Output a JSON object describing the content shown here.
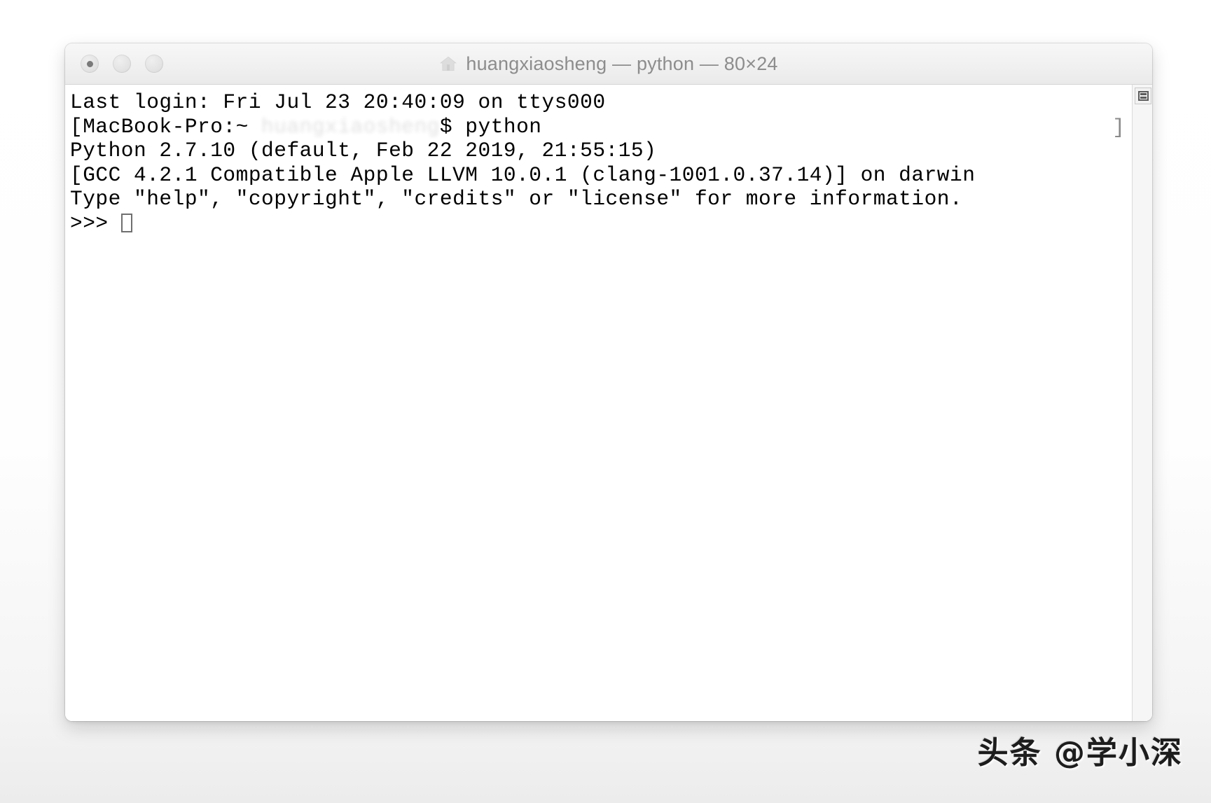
{
  "window": {
    "title": "huangxiaosheng — python — 80×24",
    "title_icon": "home-icon",
    "traffic_lights": [
      {
        "name": "close-button",
        "label": "close"
      },
      {
        "name": "minimize-button",
        "label": "minimize"
      },
      {
        "name": "zoom-button",
        "label": "zoom"
      }
    ]
  },
  "terminal": {
    "lines": [
      "Last login: Fri Jul 23 20:40:09 on ttys000",
      "Python 2.7.10 (default, Feb 22 2019, 21:55:15)",
      "[GCC 4.2.1 Compatible Apple LLVM 10.0.1 (clang-1001.0.37.14)] on darwin",
      "Type \"help\", \"copyright\", \"credits\" or \"license\" for more information."
    ],
    "shell_prompt": {
      "prefix": "[MacBook-Pro:~ ",
      "redacted_user": "huangxiaosheng",
      "sigil": "$ ",
      "command": "python",
      "trailing_bracket": "]"
    },
    "python_prompt": ">>> ",
    "cursor": "block-cursor",
    "scrollbar_thumb": "scroll-thumb-icon"
  },
  "watermark": {
    "text": "头条 @学小深"
  },
  "colors": {
    "titlebar_top": "#f7f7f7",
    "titlebar_bottom": "#eaeaea",
    "title_text": "#8d8d8d",
    "terminal_bg": "#ffffff",
    "terminal_text": "#000000",
    "scrollbar_bg": "#f6f6f6"
  }
}
